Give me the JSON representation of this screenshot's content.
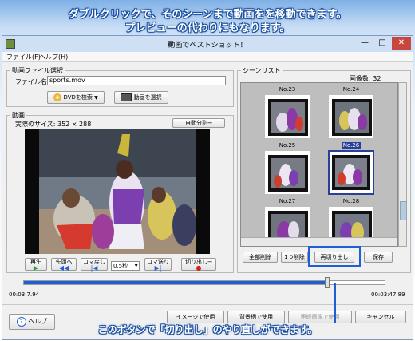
{
  "captions": {
    "top_line1": "ダブルクリックで、そのシーンまで動画をを移動できます。",
    "top_line2": "プレビューの代わりにもなります。",
    "bottom": "このボタンで「切り出し」のやり直しができます。"
  },
  "window": {
    "title": "動画でベストショット！",
    "minimize": "—",
    "maximize": "□",
    "close": "✕"
  },
  "menu": {
    "file": "ファイル(F)",
    "help": "ヘルプ(H)"
  },
  "file_group": {
    "label": "動画ファイル選択",
    "filename_label": "ファイル名",
    "filename_value": "sports.mov",
    "dvd_button": "DVDを検索",
    "select_button": "動画を選択"
  },
  "video_group": {
    "label": "動画",
    "size_text": "実際のサイズ: 352 × 288",
    "auto_split": "自動分割→"
  },
  "controls": {
    "play": "再生",
    "to_start": "先頭へ",
    "frame_back": "コマ戻し",
    "step_select": "0.5秒",
    "frame_forward": "コマ送り",
    "cut": "切り出し→"
  },
  "timeline": {
    "start": "00:03:7.94",
    "end": "00:03:47.89",
    "progress": 0.84
  },
  "scene_list": {
    "label": "シーンリスト",
    "count_text": "画像数: 32",
    "labels": [
      "No.23",
      "No.24",
      "No.25",
      "No.26",
      "No.27",
      "No.28"
    ],
    "selected": "No.28",
    "buttons": {
      "delete_all": "全部削除",
      "delete_one": "1つ削除",
      "recut": "再切り出し",
      "save": "保存"
    }
  },
  "footer": {
    "help": "ヘルプ",
    "use_image": "イメージで使用",
    "use_background": "背景柄で使用",
    "use_all": "連続画像で使用",
    "cancel": "キャンセル"
  },
  "colors": {
    "highlight": "#1f5fd6",
    "caption": "#ffffff",
    "selection": "#2a3f9a"
  }
}
